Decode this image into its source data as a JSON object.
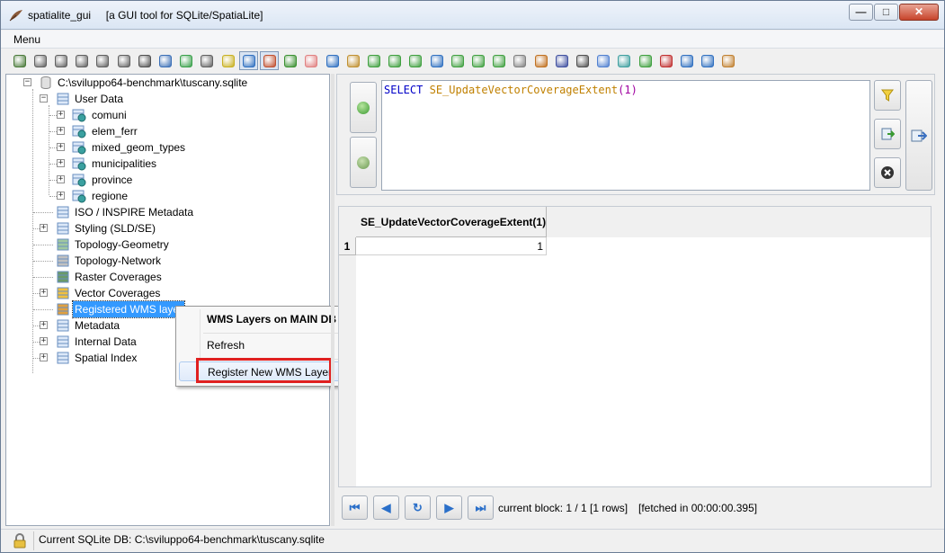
{
  "window": {
    "app_name": "spatialite_gui",
    "subtitle": "[a GUI tool for SQLite/SpatiaLite]",
    "minimize": "—",
    "maximize": "□",
    "close": "✕"
  },
  "menubar": {
    "menu": "Menu"
  },
  "toolbar": {
    "icon_colors": [
      "#4a7a3a",
      "#606060",
      "#606060",
      "#606060",
      "#606060",
      "#606060",
      "#505050",
      "#3b6fb6",
      "#39a04a",
      "#606060",
      "#c8b020",
      "#3070c0",
      "#c05030",
      "#3a9030",
      "#e08080",
      "#3070c0",
      "#c09030",
      "#40a040",
      "#40a040",
      "#40a040",
      "#3070c0",
      "#40a040",
      "#40a040",
      "#40a040",
      "#808080",
      "#c07020",
      "#4050a0",
      "#505050",
      "#5080d0",
      "#40a0a0",
      "#40a040",
      "#c03030",
      "#3070c0",
      "#3070c0",
      "#c08030"
    ]
  },
  "tree": {
    "root": "C:\\sviluppo64-benchmark\\tuscany.sqlite",
    "user_data": "User Data",
    "tables": [
      "comuni",
      "elem_ferr",
      "mixed_geom_types",
      "municipalities",
      "province",
      "regione"
    ],
    "iso_metadata": "ISO / INSPIRE Metadata",
    "styling": "Styling (SLD/SE)",
    "topology_geometry": "Topology-Geometry",
    "topology_network": "Topology-Network",
    "raster_coverages": "Raster Coverages",
    "vector_coverages": "Vector Coverages",
    "registered_wms": "Registered WMS layer",
    "metadata": "Metadata",
    "internal_data": "Internal Data",
    "spatial_index": "Spatial Index",
    "expander_plus": "+",
    "expander_minus": "−"
  },
  "context_menu": {
    "header": "WMS Layers on MAIN DB",
    "refresh": "Refresh",
    "register": "Register New WMS Layer"
  },
  "sql": {
    "keyword": "SELECT",
    "function": "SE_UpdateVectorCoverageExtent",
    "open_paren": "(",
    "argument": "1",
    "close_paren": ")"
  },
  "results": {
    "column_header": "SE_UpdateVectorCoverageExtent(1)",
    "row_number": "1",
    "cell_value": "1"
  },
  "navigation": {
    "first": "⏮",
    "prev": "◀",
    "refresh": "↻",
    "next": "▶",
    "last": "⏭",
    "block_info": "current block: 1 / 1 [1 rows]",
    "fetch_info": "[fetched in 00:00:00.395]"
  },
  "status": {
    "text": "Current SQLite DB: C:\\sviluppo64-benchmark\\tuscany.sqlite"
  }
}
